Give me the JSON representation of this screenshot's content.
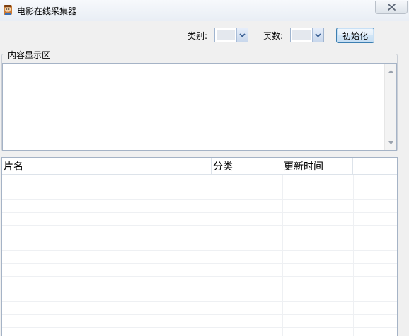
{
  "window": {
    "title": "电影在线采集器",
    "icon": "app-character-icon",
    "close_icon": "close-icon"
  },
  "toolbar": {
    "category_label": "类别:",
    "category_value": "",
    "pages_label": "页数:",
    "pages_value": "",
    "init_button": "初始化"
  },
  "content_group": {
    "legend": "内容显示区",
    "text": ""
  },
  "list": {
    "columns": [
      "片名",
      "分类",
      "更新时间",
      ""
    ],
    "rows": []
  },
  "colors": {
    "window_bg": "#f0f0f0",
    "button_border": "#3c7fb1",
    "field_border": "#a5b3c6"
  }
}
